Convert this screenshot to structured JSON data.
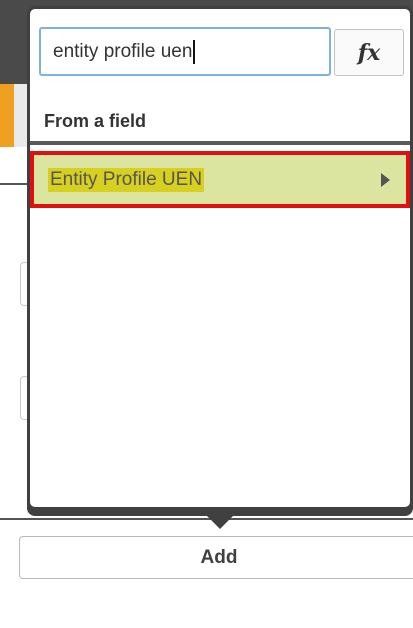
{
  "search": {
    "value": "entity profile uen"
  },
  "fx_button": {
    "label": "fx"
  },
  "section": {
    "header": "From a field"
  },
  "results": [
    {
      "label": "Entity Profile UEN"
    }
  ],
  "add_button": {
    "label": "Add"
  },
  "colors": {
    "popover_frame": "#404040",
    "search_focus_border": "#7fb0de",
    "item_background": "#dbe5a0",
    "item_text_highlight": "#d8d020",
    "selection_outline": "#e01010",
    "accent_tab": "#f0a020"
  },
  "icons": {
    "expand_arrow": "chevron-right-icon"
  }
}
